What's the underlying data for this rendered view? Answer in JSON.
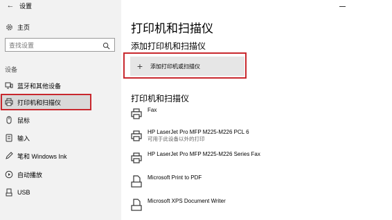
{
  "window": {
    "title": "设置"
  },
  "sidebar": {
    "home_label": "主页",
    "search_placeholder": "查找设置",
    "section_label": "设备",
    "items": [
      {
        "label": "蓝牙和其他设备",
        "icon": "bluetooth-devices-icon"
      },
      {
        "label": "打印机和扫描仪",
        "icon": "printer-icon",
        "selected": true
      },
      {
        "label": "鼠标",
        "icon": "mouse-icon"
      },
      {
        "label": "输入",
        "icon": "keyboard-icon"
      },
      {
        "label": "笔和 Windows Ink",
        "icon": "pen-icon"
      },
      {
        "label": "自动播放",
        "icon": "autoplay-icon"
      },
      {
        "label": "USB",
        "icon": "usb-icon"
      }
    ]
  },
  "main": {
    "title": "打印机和扫描仪",
    "add_heading": "添加打印机和扫描仪",
    "add_button_label": "添加打印机或扫描仪",
    "list_heading": "打印机和扫描仪",
    "printers": [
      {
        "name": "Fax",
        "status": "",
        "icon": "fax-printer-icon"
      },
      {
        "name": "HP LaserJet Pro MFP M225-M226 PCL 6",
        "status": "可用于此设备以外的打印",
        "icon": "printer-icon"
      },
      {
        "name": "HP LaserJet Pro MFP M225-M226 Series Fax",
        "status": "",
        "icon": "printer-icon"
      },
      {
        "name": "Microsoft Print to PDF",
        "status": "",
        "icon": "document-printer-icon"
      },
      {
        "name": "Microsoft XPS Document Writer",
        "status": "",
        "icon": "document-printer-icon"
      }
    ]
  },
  "colors": {
    "highlight_border": "#c8272d",
    "sidebar_bg": "#f2f2f2",
    "selected_bg": "#d9d9d9"
  }
}
